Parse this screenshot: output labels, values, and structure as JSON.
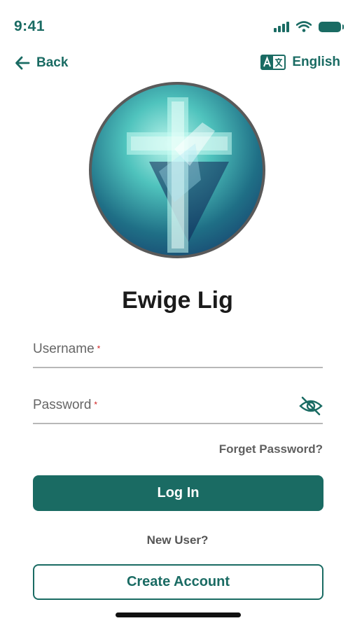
{
  "status_bar": {
    "time": "9:41"
  },
  "nav": {
    "back_label": "Back",
    "language_label": "English"
  },
  "profile": {
    "name": "Ewige Lig"
  },
  "form": {
    "username_label": "Username",
    "password_label": "Password",
    "required_mark": "*",
    "forgot_label": "Forget Password?",
    "login_label": "Log In",
    "new_user_label": "New User?",
    "create_label": "Create Account"
  },
  "colors": {
    "accent": "#1a6b63",
    "required": "#d01f1f"
  }
}
